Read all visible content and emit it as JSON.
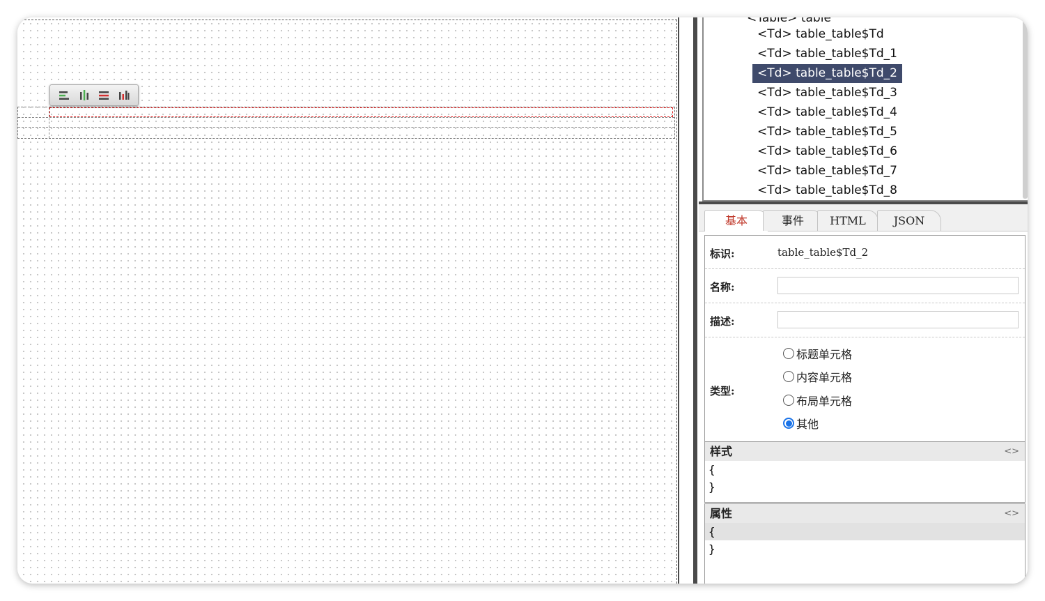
{
  "toolbar": {
    "buttons": [
      {
        "icon": "align-left-icon"
      },
      {
        "icon": "align-center-icon"
      },
      {
        "icon": "align-right-icon"
      },
      {
        "icon": "distribute-icon"
      }
    ]
  },
  "tree": {
    "partial_top": "<Table> table",
    "items": [
      {
        "label": "<Td> table_table$Td",
        "selected": false
      },
      {
        "label": "<Td> table_table$Td_1",
        "selected": false
      },
      {
        "label": "<Td> table_table$Td_2",
        "selected": true
      },
      {
        "label": "<Td> table_table$Td_3",
        "selected": false
      },
      {
        "label": "<Td> table_table$Td_4",
        "selected": false
      },
      {
        "label": "<Td> table_table$Td_5",
        "selected": false
      },
      {
        "label": "<Td> table_table$Td_6",
        "selected": false
      },
      {
        "label": "<Td> table_table$Td_7",
        "selected": false
      },
      {
        "label": "<Td> table_table$Td_8",
        "selected": false
      }
    ]
  },
  "tabs": [
    {
      "label": "基本",
      "active": true
    },
    {
      "label": "事件",
      "active": false
    },
    {
      "label": "HTML",
      "active": false
    },
    {
      "label": "JSON",
      "active": false
    }
  ],
  "form": {
    "id_label": "标识:",
    "id_value": "table_table$Td_2",
    "name_label": "名称:",
    "name_value": "",
    "desc_label": "描述:",
    "desc_value": "",
    "type_label": "类型:",
    "type_options": [
      {
        "label": "标题单元格",
        "checked": false
      },
      {
        "label": "内容单元格",
        "checked": false
      },
      {
        "label": "布局单元格",
        "checked": false
      },
      {
        "label": "其他",
        "checked": true
      }
    ]
  },
  "style_section": {
    "title": "样式",
    "toggle": "<>",
    "lines": [
      "{",
      "}"
    ]
  },
  "attr_section": {
    "title": "属性",
    "toggle": "<>",
    "lines": [
      "{",
      "}"
    ]
  },
  "colors": {
    "selection": "#3f4a6b",
    "active_tab_text": "#c0392b",
    "selected_cell_border": "#e02020",
    "radio_checked": "#1a73e8"
  }
}
